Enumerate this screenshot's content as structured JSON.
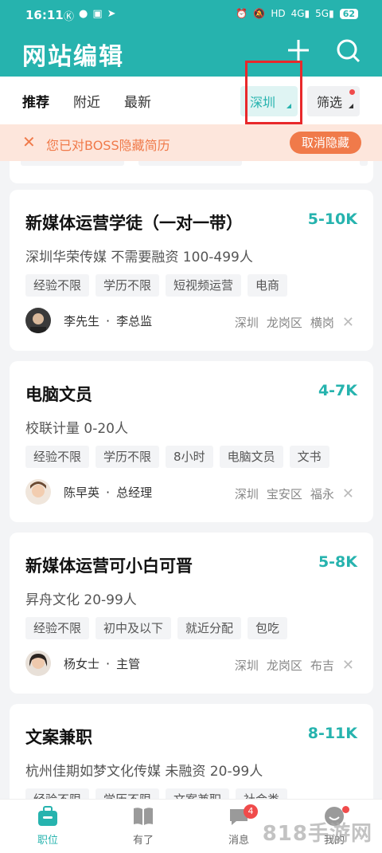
{
  "colors": {
    "accent": "#26b3ae",
    "notice_bg": "#fde6dc",
    "notice_text": "#f07a4a",
    "highlight_box": "#e8292b"
  },
  "status_bar": {
    "time": "16:11",
    "left_icons": [
      "K",
      "chat",
      "app",
      "telegram"
    ],
    "battery": "62"
  },
  "header": {
    "title": "网站编辑",
    "add_icon": "plus-icon",
    "search_icon": "search-icon"
  },
  "tabs": [
    {
      "label": "推荐",
      "active": true
    },
    {
      "label": "附近",
      "active": false
    },
    {
      "label": "最新",
      "active": false
    }
  ],
  "city_filter": "深圳",
  "filter_label": "筛选",
  "notice": {
    "text": "您已对BOSS隐藏简历",
    "button": "取消隐藏"
  },
  "jobs": [
    {
      "title": "新媒体运营学徒（一对一带）",
      "salary": "5-10K",
      "company": "深圳华荣传媒  不需要融资  100-499人",
      "tags": [
        "经验不限",
        "学历不限",
        "短视频运营",
        "电商"
      ],
      "person": "李先生",
      "role": "李总监",
      "location": [
        "深圳",
        "龙岗区",
        "横岗"
      ]
    },
    {
      "title": "电脑文员",
      "salary": "4-7K",
      "company": "校联计量  0-20人",
      "tags": [
        "经验不限",
        "学历不限",
        "8小时",
        "电脑文员",
        "文书"
      ],
      "person": "陈早英",
      "role": "总经理",
      "location": [
        "深圳",
        "宝安区",
        "福永"
      ]
    },
    {
      "title": "新媒体运营可小白可晋",
      "salary": "5-8K",
      "company": "昇舟文化  20-99人",
      "tags": [
        "经验不限",
        "初中及以下",
        "就近分配",
        "包吃"
      ],
      "person": "杨女士",
      "role": "主管",
      "location": [
        "深圳",
        "龙岗区",
        "布吉"
      ]
    },
    {
      "title": "文案兼职",
      "salary": "8-11K",
      "company": "杭州佳期如梦文化传媒  未融资  20-99人",
      "tags": [
        "经验不限",
        "学历不限",
        "文案兼职",
        "社会类"
      ]
    }
  ],
  "bottom_nav": [
    {
      "label": "职位",
      "icon": "briefcase-icon",
      "active": true
    },
    {
      "label": "有了",
      "icon": "book-icon",
      "active": false
    },
    {
      "label": "消息",
      "icon": "message-icon",
      "active": false,
      "badge": "4"
    },
    {
      "label": "我的",
      "icon": "profile-icon",
      "active": false
    }
  ],
  "watermark": "818手游网"
}
